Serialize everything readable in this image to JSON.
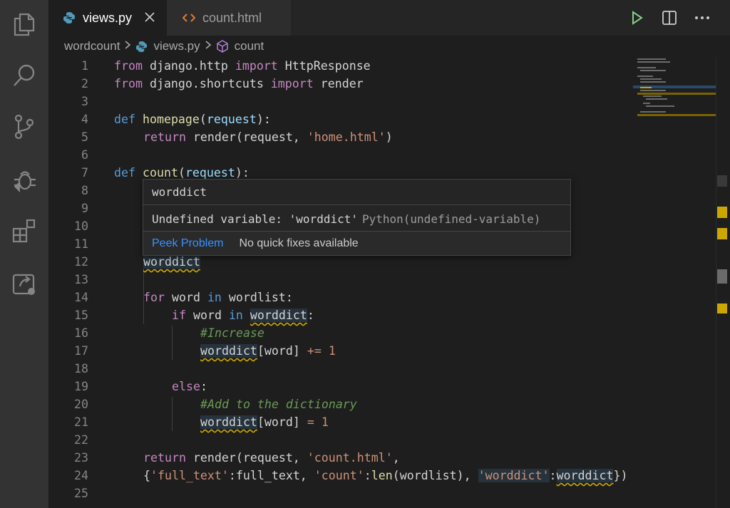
{
  "tabs": [
    {
      "label": "views.py",
      "active": true
    },
    {
      "label": "count.html",
      "active": false
    }
  ],
  "breadcrumb": {
    "folder": "wordcount",
    "file": "views.py",
    "symbol": "count"
  },
  "hover": {
    "title": "worddict",
    "message": "Undefined variable: 'worddict'",
    "source": "Python(undefined-variable)",
    "peek_label": "Peek Problem",
    "no_fix_label": "No quick fixes available"
  },
  "code": {
    "l1": {
      "n": "1",
      "a": "from",
      "b": " django.http ",
      "c": "import",
      "d": " HttpResponse"
    },
    "l2": {
      "n": "2",
      "a": "from",
      "b": " django.shortcuts ",
      "c": "import",
      "d": " render"
    },
    "l3": {
      "n": "3"
    },
    "l4": {
      "n": "4",
      "a": "def",
      "b": " ",
      "c": "homepage",
      "d": "(",
      "e": "request",
      "f": "):"
    },
    "l5": {
      "n": "5",
      "a": "return",
      "b": " render(request, ",
      "c": "'home.html'",
      "d": ")"
    },
    "l6": {
      "n": "6"
    },
    "l7": {
      "n": "7",
      "a": "def",
      "b": " ",
      "c": "count",
      "d": "(",
      "e": "request",
      "f": "):"
    },
    "l8": {
      "n": "8"
    },
    "l9": {
      "n": "9"
    },
    "l10": {
      "n": "10"
    },
    "l11": {
      "n": "11"
    },
    "l12": {
      "n": "12",
      "a": "worddict"
    },
    "l13": {
      "n": "13"
    },
    "l14": {
      "n": "14",
      "a": "for",
      "b": " word ",
      "c": "in",
      "d": " wordlist:"
    },
    "l15": {
      "n": "15",
      "a": "if",
      "b": " word ",
      "c": "in",
      "d": " ",
      "e": "worddict",
      "f": ":"
    },
    "l16": {
      "n": "16",
      "a": "#Increase"
    },
    "l17": {
      "n": "17",
      "a": "worddict",
      "b": "[word] ",
      "c": "+=",
      "d": " ",
      "e": "1"
    },
    "l18": {
      "n": "18"
    },
    "l19": {
      "n": "19",
      "a": "else",
      "b": ":"
    },
    "l20": {
      "n": "20",
      "a": "#Add to the dictionary"
    },
    "l21": {
      "n": "21",
      "a": "worddict",
      "b": "[word] ",
      "c": "=",
      "d": " ",
      "e": "1"
    },
    "l22": {
      "n": "22"
    },
    "l23": {
      "n": "23",
      "a": "return",
      "b": " render(request, ",
      "c": "'count.html'",
      "d": ","
    },
    "l24": {
      "n": "24",
      "a": "{",
      "b": "'full_text'",
      "c": ":full_text, ",
      "d": "'count'",
      "e": ":",
      "f": "len",
      "g": "(wordlist), ",
      "h": "'worddict'",
      "i": ":",
      "j": "worddict",
      "k": "})"
    },
    "l25": {
      "n": "25"
    }
  },
  "colors": {
    "editor_bg": "#1e1e1e",
    "activity_bar": "#333333",
    "warning": "#cca700",
    "link": "#3794ff"
  },
  "icons": [
    "explorer-icon",
    "search-icon",
    "source-control-icon",
    "debug-icon",
    "extensions-icon",
    "remote-icon",
    "python-icon",
    "html-icon",
    "close-icon",
    "run-icon",
    "split-editor-icon",
    "more-icon",
    "symbol-method-icon"
  ]
}
